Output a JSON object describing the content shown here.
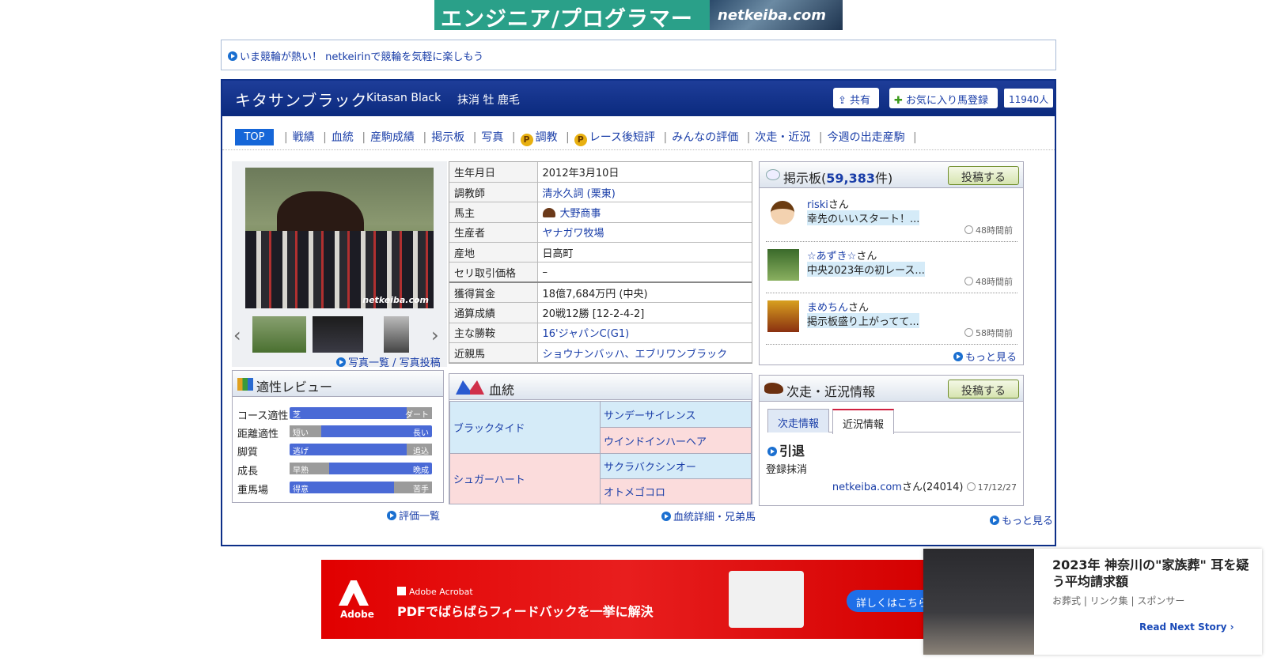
{
  "top_banner": {
    "text": "エンジニア/プログラマー",
    "logo": "netkeiba.com"
  },
  "news": {
    "text": "いま競輪が熱い！ netkeirinで競輪を気軽に楽しもう"
  },
  "horse": {
    "name": "キタサンブラック",
    "name_en": "Kitasan Black",
    "info": "抹消  牡  鹿毛",
    "share": "共有",
    "fav": "お気に入り馬登録",
    "fav_count": "11940人"
  },
  "tabs": {
    "top": "TOP",
    "items": [
      "戦績",
      "血統",
      "産駒成績",
      "掲示板",
      "写真",
      "調教",
      "レース後短評",
      "みんなの評価",
      "次走・近況",
      "今週の出走産駒"
    ]
  },
  "photo": {
    "watermark": "netkeiba.com",
    "links": "写真一覧 / 写真投稿"
  },
  "profile": [
    {
      "k": "生年月日",
      "v": "2012年3月10日"
    },
    {
      "k": "調教師",
      "v": "清水久詞 (栗東)"
    },
    {
      "k": "馬主",
      "v": "大野商事"
    },
    {
      "k": "生産者",
      "v": "ヤナガワ牧場"
    },
    {
      "k": "産地",
      "v": "日高町"
    },
    {
      "k": "セリ取引価格",
      "v": "–"
    },
    {
      "k": "獲得賞金",
      "v": "18億7,684万円 (中央)"
    },
    {
      "k": "通算成績",
      "v": "20戦12勝 [12-2-4-2]"
    },
    {
      "k": "主な勝鞍",
      "v": "16'ジャパンC(G1)"
    },
    {
      "k": "近親馬",
      "v": "ショウナンバッハ、エブリワンブラック"
    }
  ],
  "bbs": {
    "title": "掲示板",
    "count": "59,383",
    "count_unit": "件)",
    "post_btn": "投稿する",
    "more": "もっと見る",
    "posts": [
      {
        "user": "riski",
        "suffix": "さん",
        "msg": "幸先のいいスタート！...",
        "time": "48時間前"
      },
      {
        "user": "☆あずき☆",
        "suffix": "さん",
        "msg": "中央2023年の初レース...",
        "time": "48時間前"
      },
      {
        "user": "まめちん",
        "suffix": "さん",
        "msg": "掲示板盛り上がってて...",
        "time": "58時間前"
      }
    ]
  },
  "review": {
    "title": "適性レビュー",
    "more": "評価一覧",
    "rows": [
      {
        "label": "コース適性",
        "left": "芝",
        "right": "ダート",
        "level": 0.78
      },
      {
        "label": "距離適性",
        "left": "短い",
        "right": "長い",
        "level": 0.22
      },
      {
        "label": "脚質",
        "left": "逃げ",
        "right": "追込",
        "level": 0.82
      },
      {
        "label": "成長",
        "left": "早熟",
        "right": "晩成",
        "level": 0.28
      },
      {
        "label": "重馬場",
        "left": "得意",
        "right": "苦手",
        "level": 0.73
      }
    ]
  },
  "pedigree": {
    "title": "血統",
    "sire": "ブラックタイド",
    "dam": "シュガーハート",
    "ss": "サンデーサイレンス",
    "sd": "ウインドインハーヘア",
    "ds": "サクラバクシンオー",
    "dd": "オトメゴコロ",
    "more": "血統詳細・兄弟馬"
  },
  "next": {
    "title": "次走・近況情報",
    "post_btn": "投稿する",
    "tab1": "次走情報",
    "tab2": "近況情報",
    "heading": "引退",
    "body": "登録抹消",
    "author": "netkeiba.com",
    "author_suffix": "さん(24014)",
    "date": "17/12/27",
    "more": "もっと見る"
  },
  "bottom_ad": {
    "brand": "Adobe Acrobat",
    "headline": "PDFでばらばらフィードバックを一挙に解決",
    "logo": "Adobe",
    "cta": "詳しくはこちら"
  },
  "native_ad": {
    "title": "2023年 神奈川の\"家族葬\" 耳を疑う平均請求額",
    "source": "お葬式 | リンク集 | スポンサー",
    "cta": "Read Next Story"
  }
}
